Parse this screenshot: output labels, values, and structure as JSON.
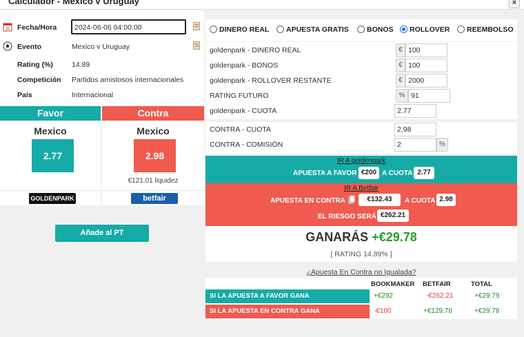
{
  "window": {
    "title": "Calculador - Mexico v Uruguay",
    "close": "×"
  },
  "info": {
    "date_label": "Fecha/Hora",
    "date_value": "2024-06-06 04:00:00",
    "event_label": "Evento",
    "event_value": "Mexico v Uruguay",
    "rating_label": "Rating (%)",
    "rating_value": "14.89",
    "comp_label": "Competición",
    "comp_value": "Partidos amistosos internacionales",
    "country_label": "País",
    "country_value": "Internacional"
  },
  "favor": {
    "header": "Favor",
    "team": "Mexico",
    "odd": "2.77",
    "bookmaker": "GOLDENPARK"
  },
  "contra": {
    "header": "Contra",
    "team": "Mexico",
    "odd": "2.98",
    "liquidity": "€121.01 liquidez",
    "exchange": "betfair"
  },
  "add_button": "Añade al PT",
  "modes": [
    {
      "label": "DINERO REAL",
      "selected": false
    },
    {
      "label": "APUESTA GRATIS",
      "selected": false
    },
    {
      "label": "BONOS",
      "selected": false
    },
    {
      "label": "ROLLOVER",
      "selected": true
    },
    {
      "label": "REEMBOLSO",
      "selected": false
    }
  ],
  "fields": {
    "dinero_real": {
      "label": "goldenpark - DINERO REAL",
      "prefix": "€",
      "value": "100"
    },
    "bonos": {
      "label": "goldenpark - BONOS",
      "prefix": "€",
      "value": "100"
    },
    "rollover": {
      "label": "goldenpark - ROLLOVER RESTANTE",
      "prefix": "€",
      "value": "2000"
    },
    "rating_futuro": {
      "label": "RATING FUTURO",
      "prefix": "%",
      "value": "91"
    },
    "cuota": {
      "label": "goldenpark - CUOTA",
      "value": "2.77"
    },
    "contra_cuota": {
      "label": "CONTRA - CUOTA",
      "value": "2.98"
    },
    "contra_comision": {
      "label": "CONTRA - COMISIÓN",
      "value": "2",
      "suffix": "%"
    }
  },
  "ir_favor": {
    "link": "IR A goldenpark",
    "stake_label": "APUESTA A FAVOR",
    "stake": "€200",
    "odd_label": "A CUOTA",
    "odd": "2.77"
  },
  "ir_contra": {
    "link": "IR A Betfair",
    "stake_label": "APUESTA EN CONTRA",
    "stake": "€132.43",
    "odd_label": "A CUOTA",
    "odd": "2.98",
    "risk_label": "EL RIESGO SERÁ",
    "risk": "€262.21"
  },
  "result": {
    "label": "GANARÁS",
    "amount": "+€29.78",
    "rating": "[ RATING 14.89% ]"
  },
  "not_matched_link": "¿Apuesta En Contra no Igualada?",
  "table": {
    "headers": [
      "BOOKMAKER",
      "BETFAIR",
      "TOTAL"
    ],
    "rows": [
      {
        "label": "SI LA APUESTA A FAVOR GANA",
        "bookmaker": "+€292",
        "betfair": "-€262.21",
        "total": "+€29.79"
      },
      {
        "label": "SI LA APUESTA EN CONTRA GANA",
        "bookmaker": "-€100",
        "betfair": "+€129.78",
        "total": "+€29.78"
      }
    ]
  },
  "colors": {
    "teal": "#16aba7",
    "red": "#f05a4f",
    "green_text": "#2a9d2a",
    "red_text": "#e0413a"
  },
  "icons": [
    "calendar-icon",
    "soccer-ball-icon",
    "edit-icon",
    "copy-icon",
    "close-icon"
  ]
}
